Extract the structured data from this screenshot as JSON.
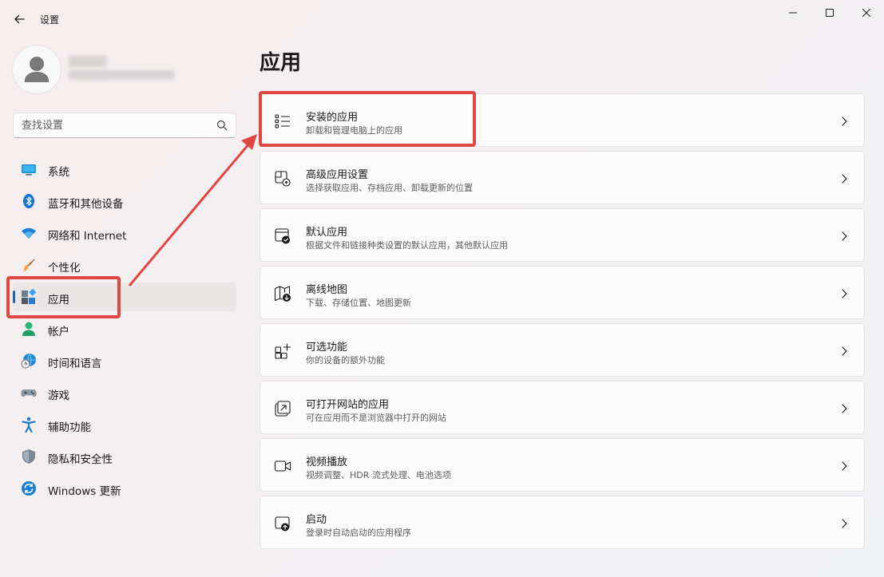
{
  "window": {
    "title": "设置"
  },
  "search": {
    "placeholder": "查找设置"
  },
  "sidebar": {
    "items": [
      {
        "label": "系统",
        "icon": "monitor-icon"
      },
      {
        "label": "蓝牙和其他设备",
        "icon": "bluetooth-icon"
      },
      {
        "label": "网络和 Internet",
        "icon": "wifi-icon"
      },
      {
        "label": "个性化",
        "icon": "brush-icon"
      },
      {
        "label": "应用",
        "icon": "apps-icon",
        "selected": true
      },
      {
        "label": "帐户",
        "icon": "account-icon"
      },
      {
        "label": "时间和语言",
        "icon": "globe-clock-icon"
      },
      {
        "label": "游戏",
        "icon": "gamepad-icon"
      },
      {
        "label": "辅助功能",
        "icon": "accessibility-icon"
      },
      {
        "label": "隐私和安全性",
        "icon": "shield-icon"
      },
      {
        "label": "Windows 更新",
        "icon": "update-icon"
      }
    ]
  },
  "main": {
    "title": "应用",
    "cards": [
      {
        "title": "安装的应用",
        "subtitle": "卸载和管理电脑上的应用",
        "icon": "list-icon"
      },
      {
        "title": "高级应用设置",
        "subtitle": "选择获取应用、存档应用、卸载更新的位置",
        "icon": "app-settings-icon"
      },
      {
        "title": "默认应用",
        "subtitle": "根据文件和链接种类设置的默认应用，其他默认应用",
        "icon": "default-apps-icon"
      },
      {
        "title": "离线地图",
        "subtitle": "下载、存储位置、地图更新",
        "icon": "map-download-icon"
      },
      {
        "title": "可选功能",
        "subtitle": "你的设备的额外功能",
        "icon": "add-features-icon"
      },
      {
        "title": "可打开网站的应用",
        "subtitle": "可在应用而不是浏览器中打开的网站",
        "icon": "open-external-icon"
      },
      {
        "title": "视频播放",
        "subtitle": "视频调整、HDR 流式处理、电池选项",
        "icon": "video-icon"
      },
      {
        "title": "启动",
        "subtitle": "登录时自动启动的应用程序",
        "icon": "startup-icon"
      }
    ]
  },
  "colors": {
    "accent": "#1e63b4",
    "annotation": "#e04642"
  }
}
